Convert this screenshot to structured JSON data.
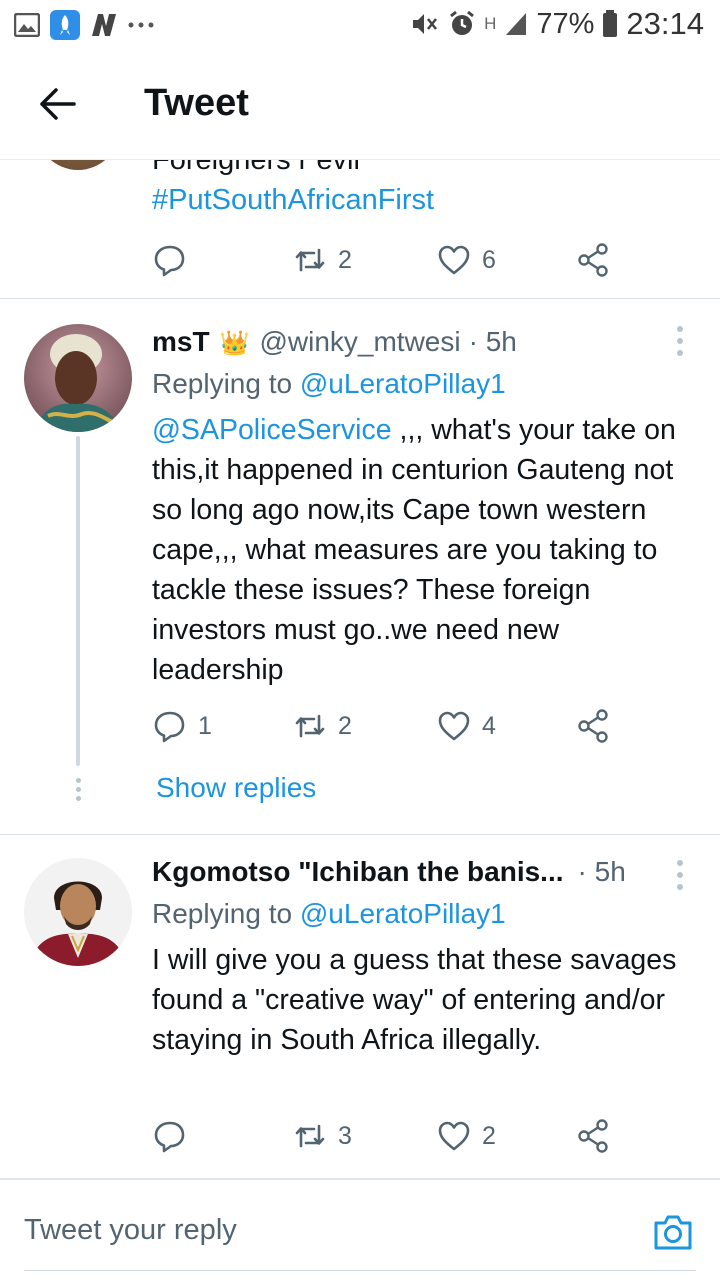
{
  "status_bar": {
    "battery": "77%",
    "time": "23:14",
    "network": "H"
  },
  "header": {
    "title": "Tweet"
  },
  "previous_tweet": {
    "text_cut": "Foreigners r evil",
    "hashtag": "#PutSouthAfricanFirst",
    "retweets": "2",
    "likes": "6"
  },
  "tweets": [
    {
      "name": "msT",
      "name_emoji": "👑",
      "handle": "@winky_mtwesi",
      "time": "· 5h",
      "replying_prefix": "Replying to ",
      "replying_to": "@uLeratoPillay1",
      "mention": "@SAPoliceService",
      "text": " ,,, what's your take on this,it happened in centurion Gauteng not so long ago now,its Cape town western cape,,, what measures are you taking to tackle these issues? These foreign investors must go..we need new leadership",
      "replies": "1",
      "retweets": "2",
      "likes": "4",
      "show_replies": "Show replies"
    },
    {
      "name": "Kgomotso \"Ichiban the banis...",
      "time": "· 5h",
      "replying_prefix": "Replying to ",
      "replying_to": "@uLeratoPillay1",
      "text": "I will give you a guess that these savages found a \"creative way\" of entering and/or staying in South Africa illegally.",
      "retweets": "3",
      "likes": "2"
    }
  ],
  "composer": {
    "placeholder": "Tweet your reply"
  },
  "colors": {
    "link": "#1b95e0",
    "secondary_text": "#536471",
    "divider": "#d9e1e7"
  },
  "icons": [
    "back-arrow-icon",
    "reply-icon",
    "retweet-icon",
    "like-icon",
    "share-icon",
    "more-icon",
    "camera-icon"
  ]
}
